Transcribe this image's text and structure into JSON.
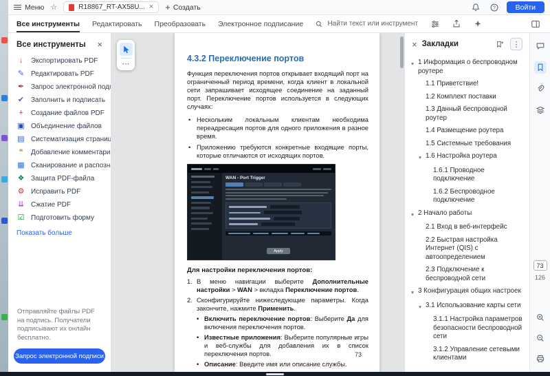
{
  "colors": {
    "accent": "#2a62f0",
    "heading": "#2d6cab"
  },
  "titlebar": {
    "menu_label": "Меню",
    "tab_title": "R18867_RT-AX58U...",
    "create_label": "Создать",
    "signin_label": "Войти"
  },
  "toolbar": {
    "tabs": [
      {
        "label": "Все инструменты",
        "active": true
      },
      {
        "label": "Редактировать",
        "active": false
      },
      {
        "label": "Преобразовать",
        "active": false
      },
      {
        "label": "Электронное подписание",
        "active": false
      }
    ],
    "search_placeholder": "Найти текст или инструмент"
  },
  "tools_panel": {
    "title": "Все инструменты",
    "items": [
      {
        "label": "Экспортировать PDF",
        "icon": "export-pdf-icon",
        "glyph": "↓",
        "color": "#d64a3b"
      },
      {
        "label": "Редактировать PDF",
        "icon": "edit-pdf-icon",
        "glyph": "✎",
        "color": "#3b63fb"
      },
      {
        "label": "Запрос электронной подпи...",
        "icon": "request-esign-icon",
        "glyph": "✒",
        "color": "#a93434"
      },
      {
        "label": "Заполнить и подписать",
        "icon": "fill-and-sign-icon",
        "glyph": "✔",
        "color": "#7a42c9"
      },
      {
        "label": "Создание файлов PDF",
        "icon": "create-pdf-icon",
        "glyph": "+",
        "color": "#d6333f"
      },
      {
        "label": "Объединение файлов",
        "icon": "combine-files-icon",
        "glyph": "▣",
        "color": "#1f4db0"
      },
      {
        "label": "Систематизация страниц",
        "icon": "organize-pages-icon",
        "glyph": "▤",
        "color": "#2d5fd0"
      },
      {
        "label": "Добавление комментария",
        "icon": "add-comment-icon",
        "glyph": "❝",
        "color": "#d98a1f"
      },
      {
        "label": "Сканирование и распознав...",
        "icon": "scan-ocr-icon",
        "glyph": "▦",
        "color": "#2f6fde"
      },
      {
        "label": "Защита PDF-файла",
        "icon": "protect-pdf-icon",
        "glyph": "❖",
        "color": "#1d7f6b"
      },
      {
        "label": "Исправить PDF",
        "icon": "repair-pdf-icon",
        "glyph": "⚙",
        "color": "#c93a32"
      },
      {
        "label": "Сжатие PDF",
        "icon": "compress-pdf-icon",
        "glyph": "⇊",
        "color": "#9b3bd1"
      },
      {
        "label": "Подготовить форму",
        "icon": "prepare-form-icon",
        "glyph": "☑",
        "color": "#1e8e3e"
      }
    ],
    "show_more_label": "Показать больше",
    "promo_text": "Отправляйте файлы PDF на подпись. Получатели подписывают их онлайн бесплатно.",
    "cta_label": "Запрос электронной подписи"
  },
  "document": {
    "heading": "4.3.2 Переключение портов",
    "intro": "Функция переключения портов открывает входящий порт на ограниченный период времени, когда клиент в локальной сети запрашивает исходящее соединение на заданный порт. Переключение портов используется в следующих случаях:",
    "bullets": [
      "Нескольким локальным клиентам необходима переадресация портов для одного приложения в разное время.",
      "Приложению требуются конкретные входящие порты, которые отличаются от исходящих портов."
    ],
    "figure": {
      "title": "WAN - Port Trigger",
      "apply_label": "Apply"
    },
    "lead": "Для настройки переключения портов:",
    "steps": [
      {
        "num": "1.",
        "text": "В меню навигации выберите **Дополнительные настройки** > **WAN** > вкладка **Переключение портов**."
      },
      {
        "num": "2.",
        "text": "Сконфигурируйте нижеследующие параметры. Когда закончите, нажмите **Применить**.",
        "sub": [
          "**Включить переключение портов**: Выберите **Да** для включения переключения портов.",
          "**Известные приложения**: Выберите популярные игры и веб-службы для добавления их в список переключения портов.",
          "**Описание**: Введите имя или описание службы."
        ]
      }
    ],
    "page_number": "73"
  },
  "bookmarks": {
    "title": "Закладки",
    "items": [
      {
        "level": 0,
        "label": "1 Информация о беспроводном роутере",
        "expandable": true
      },
      {
        "level": 1,
        "label": "1.1 Приветствие!"
      },
      {
        "level": 1,
        "label": "1.2 Комплект поставки"
      },
      {
        "level": 1,
        "label": "1.3 Данный беспроводной роутер"
      },
      {
        "level": 1,
        "label": "1.4 Размещение роутера"
      },
      {
        "level": 1,
        "label": "1.5 Системные требования"
      },
      {
        "level": 1,
        "label": "1.6 Настройка роутера",
        "expandable": true
      },
      {
        "level": 2,
        "label": "1.6.1 Проводное подключение"
      },
      {
        "level": 2,
        "label": "1.6.2 Беспроводное подключение"
      },
      {
        "level": 0,
        "label": "2 Начало работы",
        "expandable": true
      },
      {
        "level": 1,
        "label": "2.1 Вход в веб-интерфейс"
      },
      {
        "level": 1,
        "label": "2.2 Быстрая настройка Интернет (QIS) с автоопределением"
      },
      {
        "level": 1,
        "label": "2.3 Подключение к беспроводной сети"
      },
      {
        "level": 0,
        "label": "3 Конфигурация общих настроек",
        "expandable": true
      },
      {
        "level": 1,
        "label": "3.1 Использование карты сети",
        "expandable": true
      },
      {
        "level": 2,
        "label": "3.1.1 Настройка параметров безопасности беспроводной сети"
      },
      {
        "level": 2,
        "label": "3.1.2 Управление сетевыми клиентами"
      }
    ]
  },
  "right_rail": {
    "page_current": "73",
    "page_total": "126"
  }
}
